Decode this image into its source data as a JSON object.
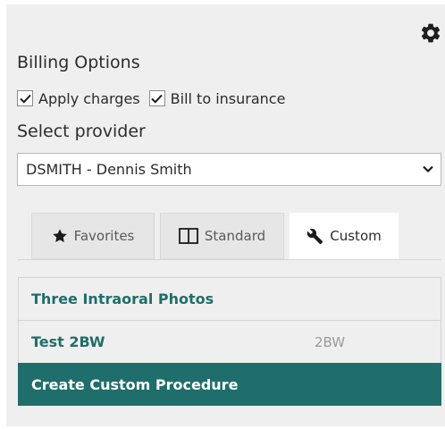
{
  "billing": {
    "title": "Billing Options",
    "apply_charges": {
      "label": "Apply charges",
      "checked": true
    },
    "bill_to_insurance": {
      "label": "Bill to insurance",
      "checked": true
    }
  },
  "provider": {
    "title": "Select provider",
    "selected": "DSMITH - Dennis Smith"
  },
  "tabs": [
    {
      "label": "Favorites",
      "icon": "star-icon",
      "active": false
    },
    {
      "label": "Standard",
      "icon": "book-icon",
      "active": false
    },
    {
      "label": "Custom",
      "icon": "wrench-icon",
      "active": true
    }
  ],
  "procedures": [
    {
      "name": "Three Intraoral Photos",
      "code": ""
    },
    {
      "name": "Test 2BW",
      "code": "2BW"
    }
  ],
  "create_button": {
    "label": "Create Custom Procedure"
  },
  "colors": {
    "accent": "#1f6e6b",
    "panel_bg": "#efefef",
    "tab_bg": "#e6e6e6"
  }
}
